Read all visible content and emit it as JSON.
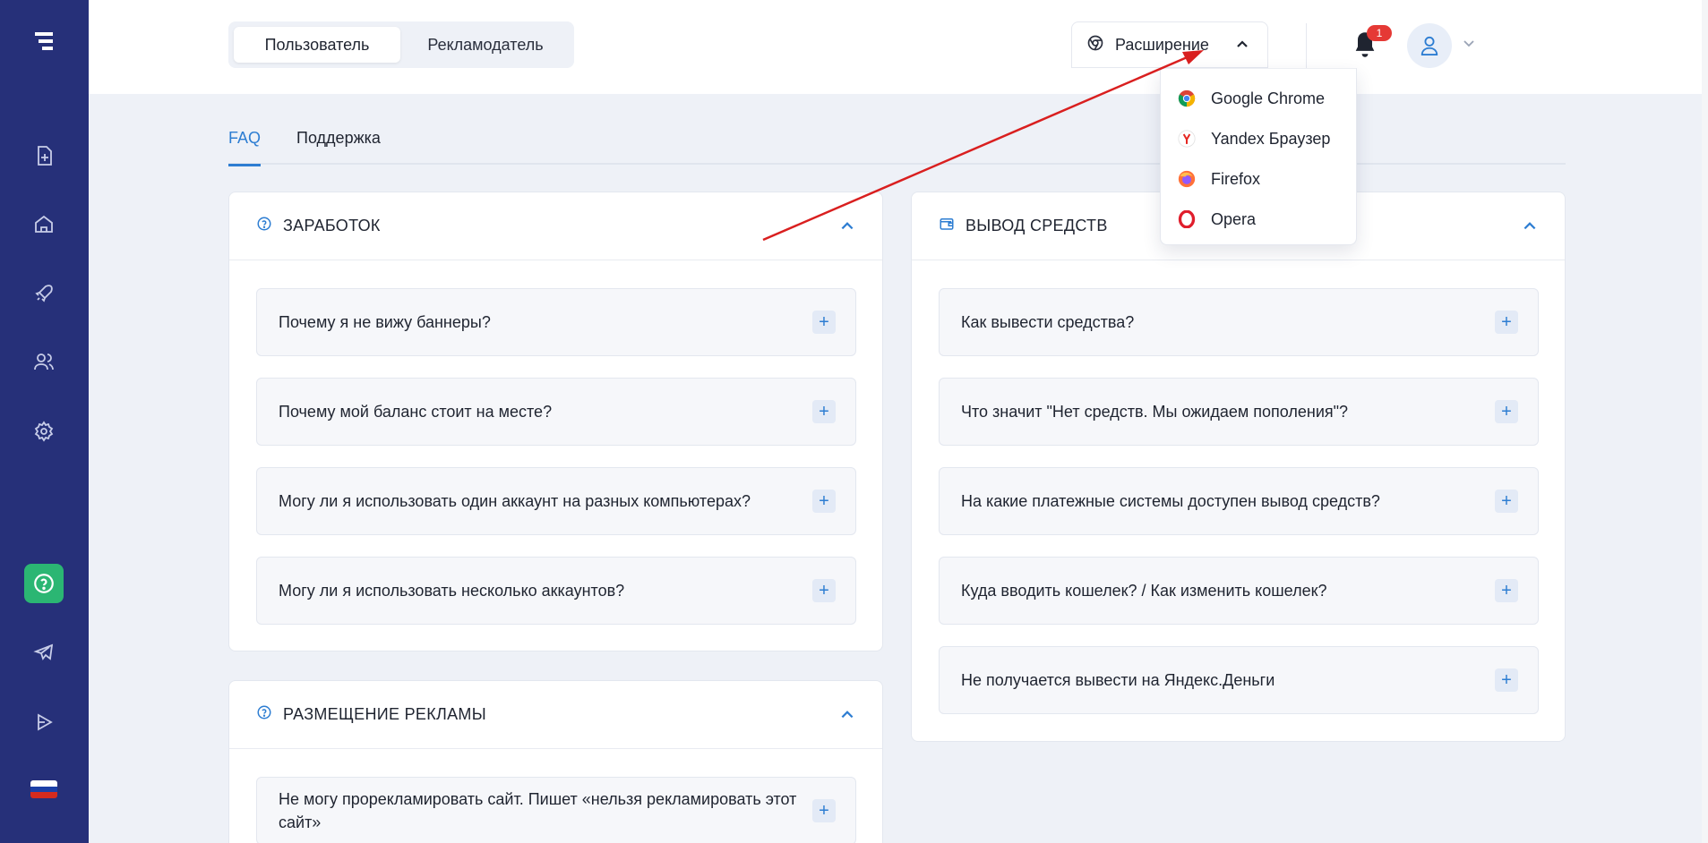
{
  "topbar": {
    "roles": [
      "Пользователь",
      "Рекламодатель"
    ],
    "extension_label": "Расширение",
    "notifications_count": "1"
  },
  "extension_menu": {
    "items": [
      {
        "label": "Google Chrome",
        "icon": "chrome-icon"
      },
      {
        "label": "Yandex Браузер",
        "icon": "yandex-browser-icon"
      },
      {
        "label": "Firefox",
        "icon": "firefox-icon"
      },
      {
        "label": "Opera",
        "icon": "opera-icon"
      }
    ]
  },
  "tabs": [
    "FAQ",
    "Поддержка"
  ],
  "sections": {
    "earnings": {
      "title": "ЗАРАБОТОК",
      "questions": [
        "Почему я не вижу баннеры?",
        "Почему мой баланс стоит на месте?",
        "Могу ли я использовать один аккаунт на разных компьютерах?",
        "Могу ли я использовать несколько аккаунтов?"
      ]
    },
    "withdrawal": {
      "title": "ВЫВОД СРЕДСТВ",
      "questions": [
        "Как вывести средства?",
        "Что значит \"Нет средств. Мы ожидаем пополения\"?",
        "На какие платежные системы доступен вывод средств?",
        "Куда вводить кошелек? / Как изменить кошелек?",
        "Не получается вывести на Яндекс.Деньги"
      ]
    },
    "advertising": {
      "title": "РАЗМЕЩЕНИЕ РЕКЛАМЫ",
      "questions": [
        "Не могу прорекламировать сайт. Пишет «нельзя рекламировать этот сайт»"
      ]
    }
  },
  "colors": {
    "sidebar": "#263079",
    "accent": "#2d7dd2",
    "help_active": "#2bb673",
    "annotation_arrow": "#d91f1f"
  }
}
